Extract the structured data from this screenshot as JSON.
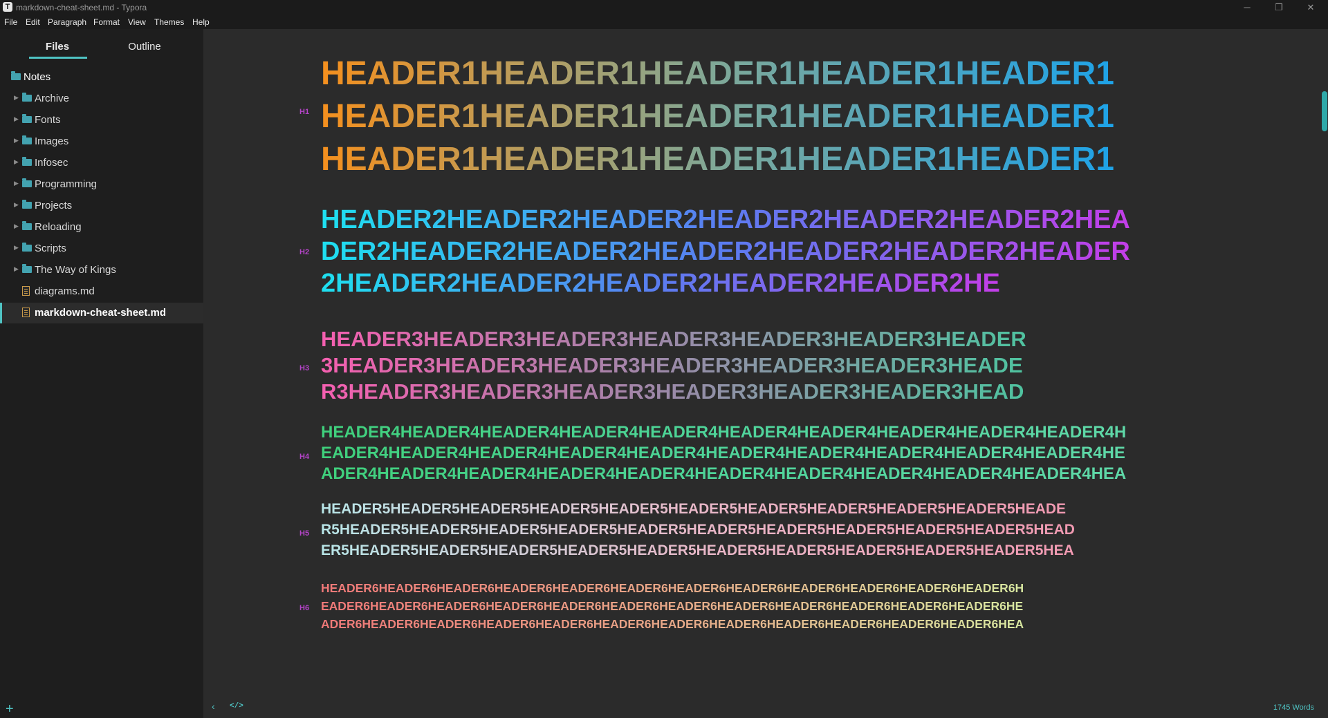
{
  "window": {
    "app_icon": "T",
    "title": "markdown-cheat-sheet.md - Typora",
    "minimize": "─",
    "maximize": "❐",
    "close": "✕"
  },
  "menu": [
    "File",
    "Edit",
    "Paragraph",
    "Format",
    "View",
    "Themes",
    "Help"
  ],
  "sidebar": {
    "tabs": {
      "files": "Files",
      "outline": "Outline"
    },
    "root": "Notes",
    "items": [
      {
        "type": "folder",
        "label": "Archive"
      },
      {
        "type": "folder",
        "label": "Fonts"
      },
      {
        "type": "folder",
        "label": "Images"
      },
      {
        "type": "folder",
        "label": "Infosec"
      },
      {
        "type": "folder",
        "label": "Programming"
      },
      {
        "type": "folder",
        "label": "Projects"
      },
      {
        "type": "folder",
        "label": "Reloading"
      },
      {
        "type": "folder",
        "label": "Scripts"
      },
      {
        "type": "folder",
        "label": "The Way of Kings"
      },
      {
        "type": "file",
        "label": "diagrams.md"
      },
      {
        "type": "file",
        "label": "markdown-cheat-sheet.md",
        "active": true
      }
    ],
    "add": "+"
  },
  "editor": {
    "headings": [
      {
        "tag": "H1",
        "lines": [
          "HEADER1HEADER1HEADER1HEADER1HEADER1",
          "HEADER1HEADER1HEADER1HEADER1HEADER1",
          "HEADER1HEADER1HEADER1HEADER1HEADER1"
        ],
        "colors": [
          "#f5901e",
          "#7fa898",
          "#1ea3e8"
        ]
      },
      {
        "tag": "H2",
        "lines": [
          "HEADER2HEADER2HEADER2HEADER2HEADER2HEADER2HEA",
          "DER2HEADER2HEADER2HEADER2HEADER2HEADER2HEADER",
          "2HEADER2HEADER2HEADER2HEADER2HEADER2HE"
        ],
        "colors": [
          "#1ee0f0",
          "#5b7cf0",
          "#c33ee8"
        ]
      },
      {
        "tag": "H3",
        "lines": [
          "HEADER3HEADER3HEADER3HEADER3HEADER3HEADER3HEADER",
          "3HEADER3HEADER3HEADER3HEADER3HEADER3HEADER3HEADE",
          "R3HEADER3HEADER3HEADER3HEADER3HEADER3HEADER3HEAD"
        ],
        "colors": [
          "#f55fb0",
          "#9a8aa8",
          "#4fc3a0"
        ]
      },
      {
        "tag": "H4",
        "lines": [
          "HEADER4HEADER4HEADER4HEADER4HEADER4HEADER4HEADER4HEADER4HEADER4HEADER4H",
          "EADER4HEADER4HEADER4HEADER4HEADER4HEADER4HEADER4HEADER4HEADER4HEADER4HE",
          "ADER4HEADER4HEADER4HEADER4HEADER4HEADER4HEADER4HEADER4HEADER4HEADER4HEA"
        ],
        "colors": [
          "#3fd07c",
          "#4fd49a",
          "#5fd8a8"
        ]
      },
      {
        "tag": "H5",
        "lines": [
          "HEADER5HEADER5HEADER5HEADER5HEADER5HEADER5HEADER5HEADER5HEADER5HEADER5HEADE",
          "R5HEADER5HEADER5HEADER5HEADER5HEADER5HEADER5HEADER5HEADER5HEADER5HEADER5HEAD",
          "ER5HEADER5HEADER5HEADER5HEADER5HEADER5HEADER5HEADER5HEADER5HEADER5HEADER5HEA"
        ],
        "colors": [
          "#b8e6e8",
          "#e8b8c8",
          "#f29ab2"
        ]
      },
      {
        "tag": "H6",
        "lines": [
          "HEADER6HEADER6HEADER6HEADER6HEADER6HEADER6HEADER6HEADER6HEADER6HEADER6HEADER6HEADER6H",
          "EADER6HEADER6HEADER6HEADER6HEADER6HEADER6HEADER6HEADER6HEADER6HEADER6HEADER6HEADER6HE",
          "ADER6HEADER6HEADER6HEADER6HEADER6HEADER6HEADER6HEADER6HEADER6HEADER6HEADER6HEADER6HEA"
        ],
        "colors": [
          "#f07878",
          "#e8a888",
          "#d8e8a0"
        ]
      }
    ]
  },
  "statusbar": {
    "back_icon": "‹",
    "code_icon": "</>",
    "word_count": "1745 Words"
  }
}
